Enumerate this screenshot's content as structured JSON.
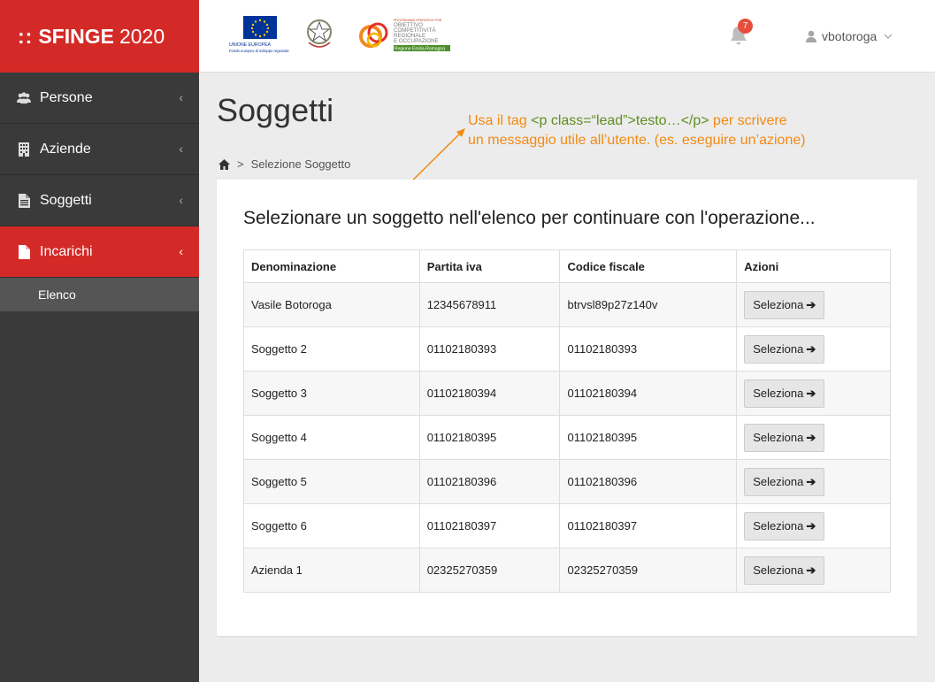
{
  "brand": {
    "dots": "::",
    "name": "SFINGE",
    "year": "2020"
  },
  "sidebar": {
    "items": [
      {
        "label": "Persone",
        "icon": "users-icon"
      },
      {
        "label": "Aziende",
        "icon": "building-icon"
      },
      {
        "label": "Soggetti",
        "icon": "document-icon"
      },
      {
        "label": "Incarichi",
        "icon": "file-icon"
      }
    ],
    "sub_items": [
      {
        "label": "Elenco"
      }
    ]
  },
  "header": {
    "logos": {
      "eu_line1": "UNIONE EUROPEA",
      "eu_line2": "Fondo europeo di sviluppo regionale",
      "por_top": "PROGRAMMA OPERATIVO POR",
      "por_line1": "OBIETTIVO",
      "por_line2": "COMPETITIVITÀ",
      "por_line3": "REGIONALE",
      "por_line4": "E OCCUPAZIONE",
      "por_bottom": "Regione Emilia-Romagna"
    },
    "notifications_count": "7",
    "user_name": "vbotoroga"
  },
  "page": {
    "title": "Soggetti",
    "breadcrumb": {
      "sep": ">",
      "current": "Selezione Soggetto"
    },
    "annotation": {
      "part1": "Usa il tag ",
      "code": "<p class=“lead”>testo…</p>",
      "part2": " per scrivere",
      "line2": "un messaggio utile all’utente. (es. eseguire un’azione)"
    },
    "lead": "Selezionare un soggetto nell'elenco per continuare con l'operazione..."
  },
  "table": {
    "headers": [
      "Denominazione",
      "Partita iva",
      "Codice fiscale",
      "Azioni"
    ],
    "button_label": "Seleziona",
    "rows": [
      [
        "Vasile Botoroga",
        "12345678911",
        "btrvsl89p27z140v"
      ],
      [
        "Soggetto 2",
        "01102180393",
        "01102180393"
      ],
      [
        "Soggetto 3",
        "01102180394",
        "01102180394"
      ],
      [
        "Soggetto 4",
        "01102180395",
        "01102180395"
      ],
      [
        "Soggetto 5",
        "01102180396",
        "01102180396"
      ],
      [
        "Soggetto 6",
        "01102180397",
        "01102180397"
      ],
      [
        "Azienda 1",
        "02325270359",
        "02325270359"
      ]
    ]
  },
  "colors": {
    "brand_red": "#d42a27",
    "sidebar_dark": "#3a3a3a",
    "annotation_orange": "#f28a12",
    "annotation_green": "#5f8e1f"
  }
}
